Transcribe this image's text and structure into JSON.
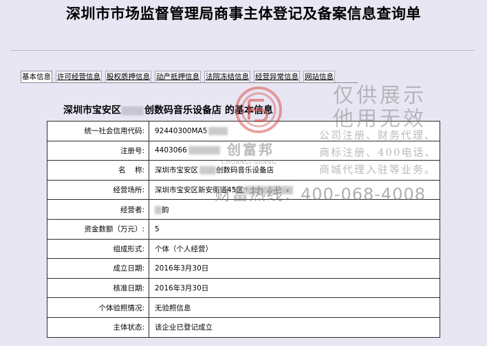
{
  "page": {
    "title": "深圳市市场监督管理局商事主体登记及备案信息查询单"
  },
  "tabs": [
    {
      "label": "基本信息",
      "active": true
    },
    {
      "label": "许可经营信息",
      "active": false
    },
    {
      "label": "股权质押信息",
      "active": false
    },
    {
      "label": "动产抵押信息",
      "active": false
    },
    {
      "label": "法院冻结信息",
      "active": false
    },
    {
      "label": "经营异常信息",
      "active": false
    },
    {
      "label": "网站信息",
      "active": false
    }
  ],
  "section": {
    "title_prefix": "深圳市宝安区",
    "title_suffix": "创数码音乐设备店 的基本信息"
  },
  "rows": [
    {
      "label": "统一社会信用代码:",
      "value": "92440300MA5"
    },
    {
      "label": "注册号:",
      "value": "4403066"
    },
    {
      "label": "名    称:",
      "value_prefix": "深圳市宝安区",
      "value_suffix": "创数码音乐设备店"
    },
    {
      "label": "经营场所:",
      "value": "深圳市宝安区新安街道45区"
    },
    {
      "label": "经营者:",
      "value": "韵"
    },
    {
      "label": "资金数额（万元）:",
      "value": "5"
    },
    {
      "label": "组成形式:",
      "value": "个体（个人经营）"
    },
    {
      "label": "成立日期:",
      "value": "2016年3月30日"
    },
    {
      "label": "核准日期:",
      "value": "2016年3月30日"
    },
    {
      "label": "个体验照情况:",
      "value": "无验照信息"
    },
    {
      "label": "主体状态:",
      "value": "该企业已登记成立"
    }
  ],
  "watermark": {
    "brand_cn": "创富邦",
    "brand_en": "CHUANGFUBANG",
    "title_line1": "仅供展示",
    "title_line2": "他用无效",
    "services_line1": "公司注册、财务代理、",
    "services_line2": "商标注册、400电话、",
    "services_line3": "商城代理入驻等业务。",
    "phone": "财富热线：400-068-4008",
    "logo_color": "#d9534f"
  },
  "colors": {
    "background": "#e9e6f3",
    "table_bg": "#ffffff",
    "border": "#2b2b2b"
  }
}
